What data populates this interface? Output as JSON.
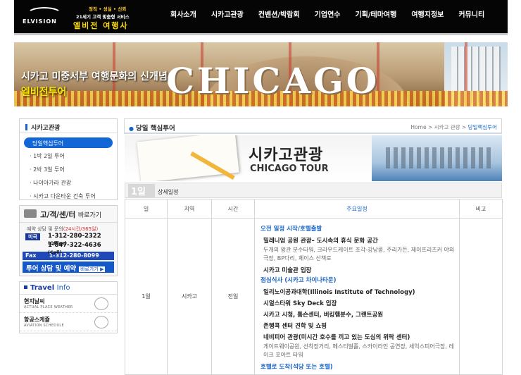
{
  "header": {
    "logo": "ELVISION",
    "slogan_top": "정직 • 성실 • 신뢰",
    "slogan_mid": "21세기 고객 맞춤형 서비스",
    "slogan_brand": "엘비전 여행사",
    "nav": [
      "회사소개",
      "시카고관광",
      "컨벤션/박람회",
      "기업연수",
      "기획/테마여행",
      "여행지정보",
      "커뮤니티"
    ]
  },
  "banner": {
    "marquee": "CHICAGO",
    "caption_line1": "시카고 미중서부 여행문화의 신개념",
    "caption_line2": "엘비전투어"
  },
  "sidebar": {
    "title": "시카고관광",
    "active": "당일핵심투어",
    "items": [
      "· 1박 2일 투어",
      "· 2박 3일 투어",
      "· 나이아가라 관광",
      "· 시카고 다운타운 건축 투어"
    ]
  },
  "customer_center": {
    "title": "고/객/센/터",
    "title_suffix": "바로가기",
    "hours_label": "예약 상담 및 문의",
    "hours_value": "(24시간/365일)",
    "country": "미국",
    "phone_office": "1-312-280-2322",
    "phone_office_tag": "(Office)",
    "phone_cell": "1-847-322-4636",
    "phone_cell_tag": "(Cell)",
    "fax_label": "Fax",
    "fax": "1-312-280-8099",
    "reserve": "투어 상담 및 예약",
    "reserve_link": "바로가기 ▶"
  },
  "travel_info": {
    "title_a": "Travel",
    "title_b": "Info",
    "items": [
      {
        "ko": "현지날씨",
        "en": "ACTUAL PLACE WEATHER"
      },
      {
        "ko": "항공스케쥴",
        "en": "AVIATION SCHEDULE"
      }
    ]
  },
  "content": {
    "title": "당일 핵심투어",
    "breadcrumb_home": "Home",
    "breadcrumb_mid": "시카고 관광",
    "breadcrumb_current": "당일핵심투어",
    "tour_title_ko": "시카고관광",
    "tour_title_en": "CHICAGO TOUR",
    "day_number": "1일",
    "day_label": "상세일정"
  },
  "schedule": {
    "headers": [
      "일",
      "지역",
      "시간",
      "주요일정",
      "비고"
    ],
    "day": "1일",
    "region": "시카고",
    "time": "전일",
    "lines": [
      {
        "style": "blue",
        "text": "오전 일정 시작/호텔출발"
      },
      {
        "style": "bold",
        "text": "밀레니엄 공원 관광– 도시속의 휴식 문화 공간"
      },
      {
        "style": "gray",
        "text": "두개의 왕관 분수타워, 크라우드케이트 조각-강낭콩, 주리가든, 제이프리츠커 야외극장, BP다리, 체이스 산책로"
      },
      {
        "style": "bold",
        "text": "시카고 미술관 입장"
      },
      {
        "style": "blue",
        "text": "점심식사 (시카고 차이나타운)"
      },
      {
        "style": "bold",
        "text": "일리노이공과대학(Illinois Institute of Technology)"
      },
      {
        "style": "bold",
        "text": "시얼스타워 Sky Deck 입장"
      },
      {
        "style": "bold",
        "text": "시카고 시청, 톰슨센터, 버킹햄분수, 그랜트공원"
      },
      {
        "style": "bold",
        "text": "존행콕 센터 견학 및 쇼핑"
      },
      {
        "style": "bold",
        "text": "네비피어 관광(미시간 호수를 끼고 있는 도심의 위락 센터)"
      },
      {
        "style": "gray",
        "text": "게이트웨이공원, 선착장거리, 페스티벌홀, 스카이라인 공연장, 세익스피어극장, 레이크 포아트 타워"
      },
      {
        "style": "blue",
        "text": "호텔로 도착(석당 또는 호텔)"
      }
    ]
  }
}
